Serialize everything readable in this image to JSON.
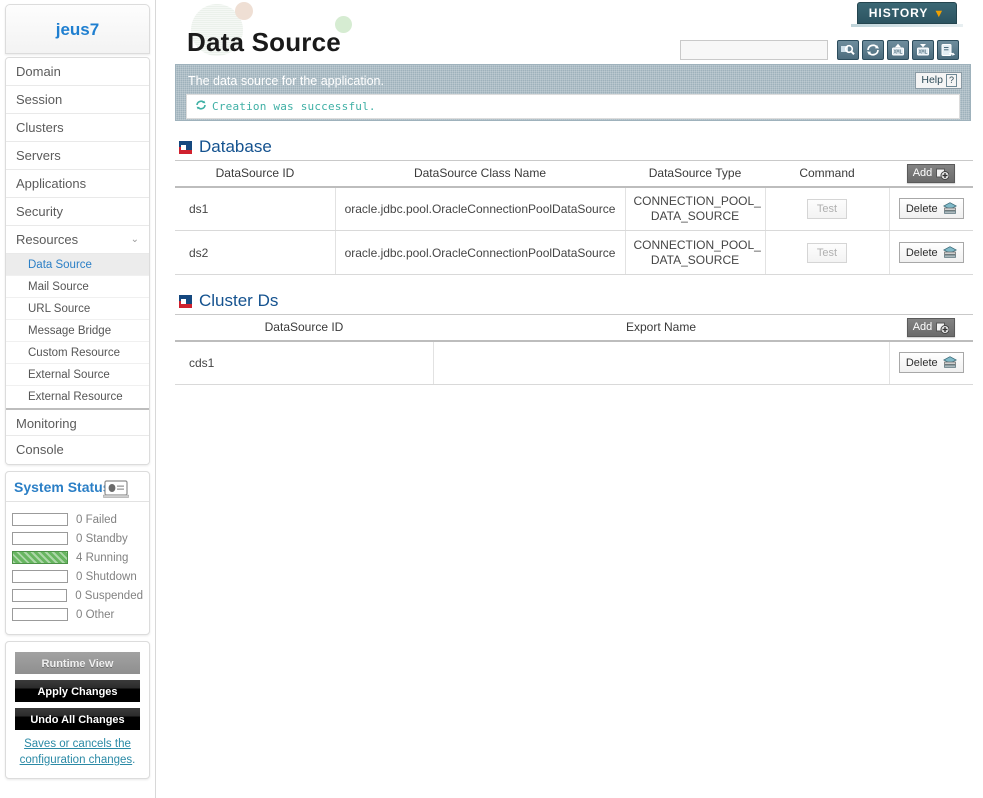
{
  "brand": {
    "name": "jeus7"
  },
  "sidebar": {
    "nav": [
      {
        "label": "Domain",
        "expandable": false
      },
      {
        "label": "Session",
        "expandable": false
      },
      {
        "label": "Clusters",
        "expandable": false
      },
      {
        "label": "Servers",
        "expandable": false
      },
      {
        "label": "Applications",
        "expandable": false
      },
      {
        "label": "Security",
        "expandable": false
      },
      {
        "label": "Resources",
        "expandable": true,
        "caret": "⌄"
      }
    ],
    "sub_items": [
      {
        "label": "Data Source",
        "active": true
      },
      {
        "label": "Mail Source",
        "active": false
      },
      {
        "label": "URL Source",
        "active": false
      },
      {
        "label": "Message Bridge",
        "active": false
      },
      {
        "label": "Custom Resource",
        "active": false
      },
      {
        "label": "External Source",
        "active": false
      },
      {
        "label": "External Resource",
        "active": false
      }
    ],
    "nav_bottom": [
      {
        "label": "Monitoring"
      },
      {
        "label": "Console"
      }
    ],
    "system_status": {
      "title": "System Status",
      "icon": "laptop-icon",
      "rows": [
        {
          "count": "0",
          "label": "Failed",
          "filled": false
        },
        {
          "count": "0",
          "label": "Standby",
          "filled": false
        },
        {
          "count": "4",
          "label": "Running",
          "filled": true
        },
        {
          "count": "0",
          "label": "Shutdown",
          "filled": false
        },
        {
          "count": "0",
          "label": "Suspended",
          "filled": false
        },
        {
          "count": "0",
          "label": "Other",
          "filled": false
        }
      ],
      "fill_color": "#68b661"
    },
    "actions": {
      "runtime_view": "Runtime View",
      "apply_changes": "Apply Changes",
      "undo_all_changes": "Undo All Changes",
      "help_text": "Saves or cancels the configuration changes",
      "help_period": "."
    }
  },
  "header": {
    "page_title": "Data Source",
    "history_label": "HISTORY",
    "history_caret": "▼",
    "search_placeholder": "",
    "search_value": "",
    "toolbar_buttons": [
      {
        "name": "search-icon",
        "title": "Search"
      },
      {
        "name": "refresh-icon",
        "title": "Refresh"
      },
      {
        "name": "xml-import-icon",
        "title": "Import XML"
      },
      {
        "name": "xml-export-icon",
        "title": "Export XML"
      },
      {
        "name": "report-icon",
        "title": "Report"
      }
    ]
  },
  "banner": {
    "description": "The data source for the application.",
    "help_label": "Help",
    "help_mark": "?",
    "message": "Creation was successful.",
    "message_icon": "refresh-success-icon",
    "message_color": "#3fb0a5"
  },
  "database_section": {
    "title": "Database",
    "icon": "square-marker-icon",
    "columns": [
      "DataSource ID",
      "DataSource Class Name",
      "DataSource Type",
      "Command"
    ],
    "add_label": "Add",
    "rows": [
      {
        "id": "ds1",
        "class_name": "oracle.jdbc.pool.OracleConnectionPoolDataSource",
        "type": "CONNECTION_POOL_ DATA_SOURCE",
        "command_label": "Test",
        "delete_label": "Delete"
      },
      {
        "id": "ds2",
        "class_name": "oracle.jdbc.pool.OracleConnectionPoolDataSource",
        "type": "CONNECTION_POOL_ DATA_SOURCE",
        "command_label": "Test",
        "delete_label": "Delete"
      }
    ]
  },
  "cluster_section": {
    "title": "Cluster Ds",
    "icon": "square-marker-icon",
    "columns": [
      "DataSource ID",
      "Export Name"
    ],
    "add_label": "Add",
    "rows": [
      {
        "id": "cds1",
        "export_name": "",
        "delete_label": "Delete"
      }
    ]
  },
  "colors": {
    "brand_blue": "#1f7fd0",
    "section_blue": "#14528f",
    "banner_bg": "#9eb1bb",
    "history_bg": "#2c5461",
    "history_caret": "#f0a000",
    "accent_teal": "#3fb0a5",
    "marker_red": "#d0212e",
    "marker_blue": "#15487f"
  }
}
